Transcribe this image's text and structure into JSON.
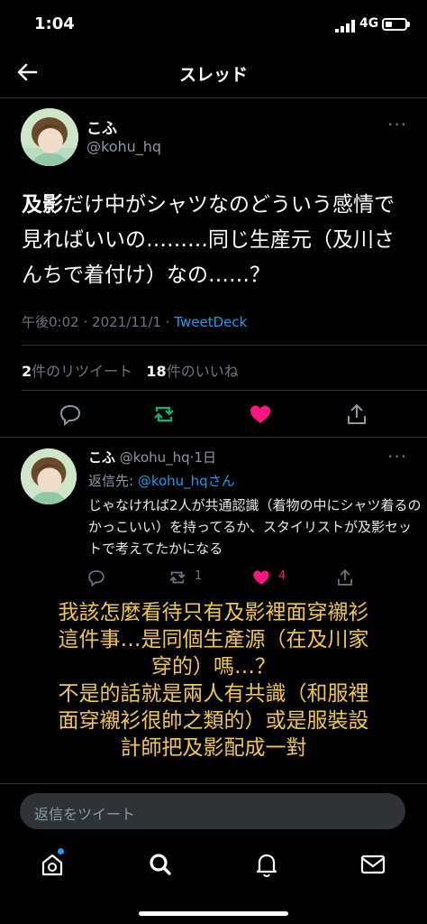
{
  "status": {
    "time": "1:04",
    "network": "4G",
    "battery_level": 0.35
  },
  "header": {
    "title": "スレッド"
  },
  "tweet": {
    "author_name": "こふ",
    "handle": "@kohu_hq",
    "text_bold": "及影",
    "text_rest": "だけ中がシャツなのどういう感情で見ればいいの………同じ生産元（及川さんちで着付け）なの……？",
    "time": "午後0:02",
    "sep1": "·",
    "date": "2021/11/1",
    "sep2": "·",
    "via": "TweetDeck",
    "retweets_count": "2",
    "retweets_label": "件のリツイート",
    "likes_count": "18",
    "likes_label": "件のいいね"
  },
  "reply": {
    "author_name": "こふ",
    "handle": "@kohu_hq",
    "sep": "·",
    "age": "1日",
    "replying_prefix": "返信先: ",
    "replying_to": "@kohu_hqさん",
    "text": "じゃなければ2人が共通認識（着物の中にシャツ着るのかっこいい）を持ってるか、スタイリストが及影セットで考えてたかになる",
    "retweets": "1",
    "likes": "4"
  },
  "caption": {
    "lines": [
      "我該怎麼看待只有及影裡面穿襯衫",
      "這件事…是同個生產源（在及川家",
      "穿的）嗎…？",
      "不是的話就是兩人有共識（和服裡",
      "面穿襯衫很帥之類的）或是服裝設",
      "計師把及影配成一對"
    ]
  },
  "reply_input": {
    "placeholder": "返信をツイート"
  },
  "colors": {
    "accent": "#1d9bf0",
    "like": "#f91880",
    "retweet": "#00ba7c",
    "caption": "#f2c84b"
  }
}
